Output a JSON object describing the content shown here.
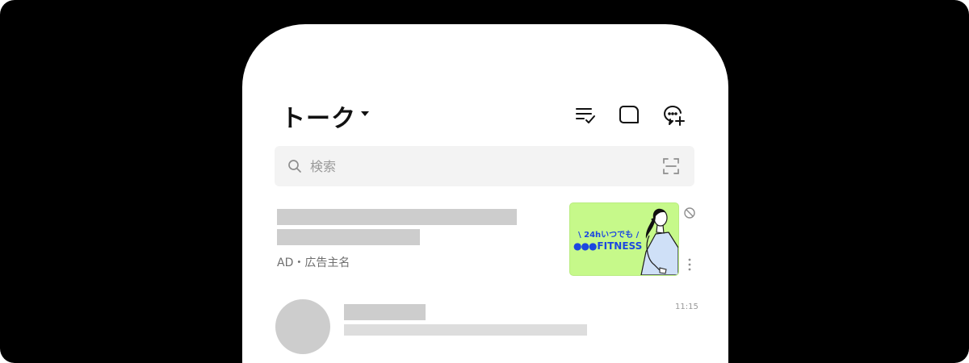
{
  "header": {
    "title": "トーク"
  },
  "search": {
    "placeholder": "検索"
  },
  "ad": {
    "meta": "AD・広告主名",
    "banner_tag": "\\ 24hいつでも /",
    "banner_brand_dots": "●●●",
    "banner_brand": "FITNESS"
  },
  "chat": {
    "time": "11:15"
  },
  "icons": {
    "caret": "caret-down-icon",
    "edit": "checklist-icon",
    "room": "chat-bubble-icon",
    "new_chat": "add-chat-icon",
    "search": "search-icon",
    "scan": "qr-scan-icon",
    "block": "block-icon",
    "more": "more-vertical-icon"
  },
  "colors": {
    "background": "#000000",
    "screen": "#ffffff",
    "placeholder_bar": "#cdcdcd",
    "banner_bg": "#c6f98a",
    "banner_text": "#1c47e0"
  }
}
